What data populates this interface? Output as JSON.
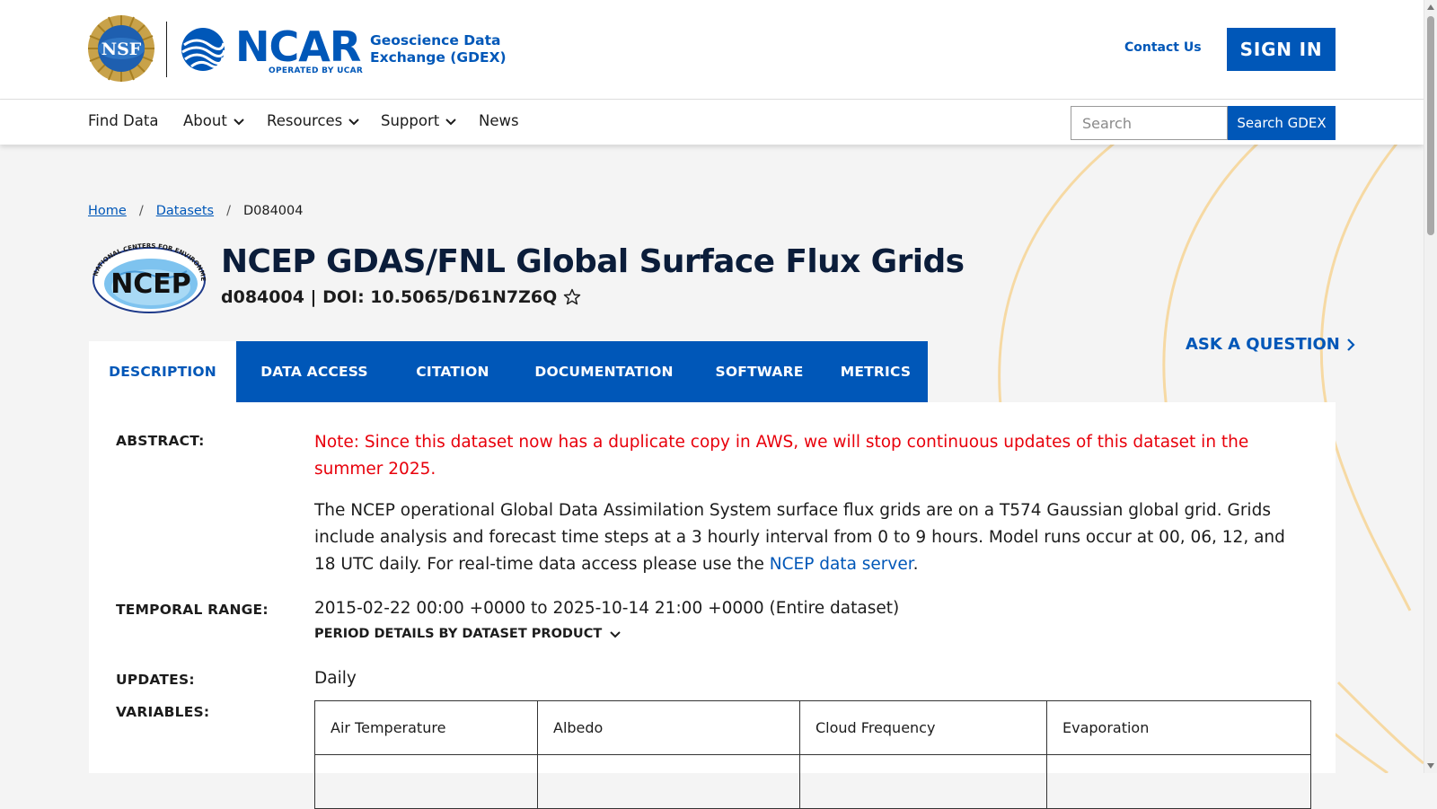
{
  "header": {
    "nsf_logo_text": "NSF",
    "ncar_wordmark": "NCAR",
    "ncar_subtitle": "OPERATED BY UCAR",
    "site_title": "Geoscience Data Exchange (GDEX)",
    "contact_label": "Contact Us",
    "signin_label": "SIGN IN"
  },
  "nav": {
    "items": [
      {
        "label": "Find Data",
        "has_dropdown": false
      },
      {
        "label": "About",
        "has_dropdown": true
      },
      {
        "label": "Resources",
        "has_dropdown": true
      },
      {
        "label": "Support",
        "has_dropdown": true
      },
      {
        "label": "News",
        "has_dropdown": false
      }
    ],
    "search_placeholder": "Search",
    "search_value": "",
    "search_button_label": "Search GDEX"
  },
  "breadcrumb": {
    "items": [
      "Home",
      "Datasets",
      "D084004"
    ],
    "separator": "/"
  },
  "dataset": {
    "logo_text": "NCEP",
    "logo_ring_text": "NATIONAL CENTERS FOR ENVIRONMENTAL PREDICTION",
    "title": "NCEP GDAS/FNL Global Surface Flux Grids",
    "doi_line": "d084004 | DOI: 10.5065/D61N7Z6Q",
    "ask_label": "ASK A QUESTION"
  },
  "tabs": [
    {
      "label": "DESCRIPTION",
      "active": true
    },
    {
      "label": "DATA ACCESS",
      "active": false
    },
    {
      "label": "CITATION",
      "active": false
    },
    {
      "label": "DOCUMENTATION",
      "active": false
    },
    {
      "label": "SOFTWARE",
      "active": false
    },
    {
      "label": "METRICS",
      "active": false
    }
  ],
  "description": {
    "abstract_label": "ABSTRACT:",
    "abstract_note": "Note: Since this dataset now has a duplicate copy in AWS, we will stop continuous updates of this dataset in the summer 2025.",
    "abstract_text": "The NCEP operational Global Data Assimilation System surface flux grids are on a T574 Gaussian global grid. Grids include analysis and forecast time steps at a 3 hourly interval from 0 to 9 hours. Model runs occur at 00, 06, 12, and 18 UTC daily. For real-time data access please use the ",
    "abstract_link": "NCEP data server",
    "abstract_end": ".",
    "temporal_label": "TEMPORAL RANGE:",
    "temporal_value": "2015-02-22 00:00 +0000 to 2025-10-14 21:00 +0000 (Entire dataset)",
    "period_toggle_label": "PERIOD DETAILS BY DATASET PRODUCT",
    "updates_label": "UPDATES:",
    "updates_value": "Daily",
    "variables_label": "VARIABLES:",
    "variables_rows": [
      [
        "Air Temperature",
        "Albedo",
        "Cloud Frequency",
        "Evaporation"
      ],
      [
        "",
        "",
        "",
        ""
      ]
    ]
  },
  "colors": {
    "brand_blue": "#0057b8",
    "note_red": "#e8000b",
    "title_navy": "#0b1d3a",
    "deco_orange": "#f6d9a3"
  }
}
